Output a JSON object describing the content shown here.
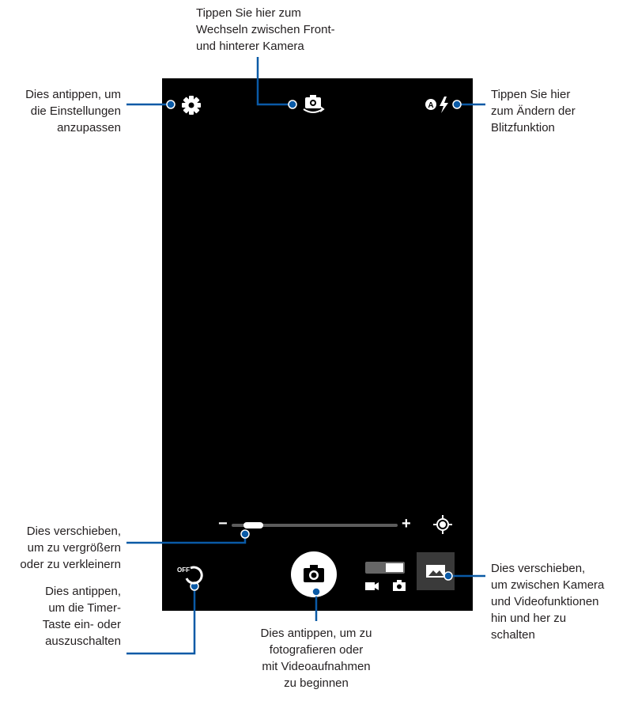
{
  "callouts": {
    "front_rear_camera": "Tippen Sie hier zum\nWechseln zwischen Front-\nund hinterer Kamera",
    "settings": "Dies antippen, um\ndie Einstellungen\nanzupassen",
    "flash": "Tippen Sie hier\nzum Ändern der\nBlitzfunktion",
    "zoom": "Dies verschieben,\num zu vergrößern\noder zu verkleinern",
    "timer": "Dies antippen,\num die Timer-\nTaste ein- oder\nauszuschalten",
    "shutter": "Dies antippen, um zu\nfotografieren oder\nmit Videoaufnahmen\nzu beginnen",
    "mode_switch": "Dies verschieben,\num zwischen Kamera\nund Videofunktionen\nhin und her zu\nschalten"
  },
  "camera_ui": {
    "timer_label": "OFF",
    "zoom_minus": "−",
    "zoom_plus": "+",
    "zoom_level": 0.08,
    "flash_mode_letter": "A",
    "icons": {
      "settings": "gear-icon",
      "switch_camera": "switch-camera-icon",
      "flash": "flash-auto-icon",
      "focus": "focus-target-icon",
      "timer": "timer-icon",
      "shutter": "camera-icon",
      "video": "video-icon",
      "photo": "photo-icon",
      "gallery": "gallery-icon"
    }
  },
  "colors": {
    "leader_line": "#0a5aa6",
    "screen": "#000000",
    "text": "#231f20"
  }
}
